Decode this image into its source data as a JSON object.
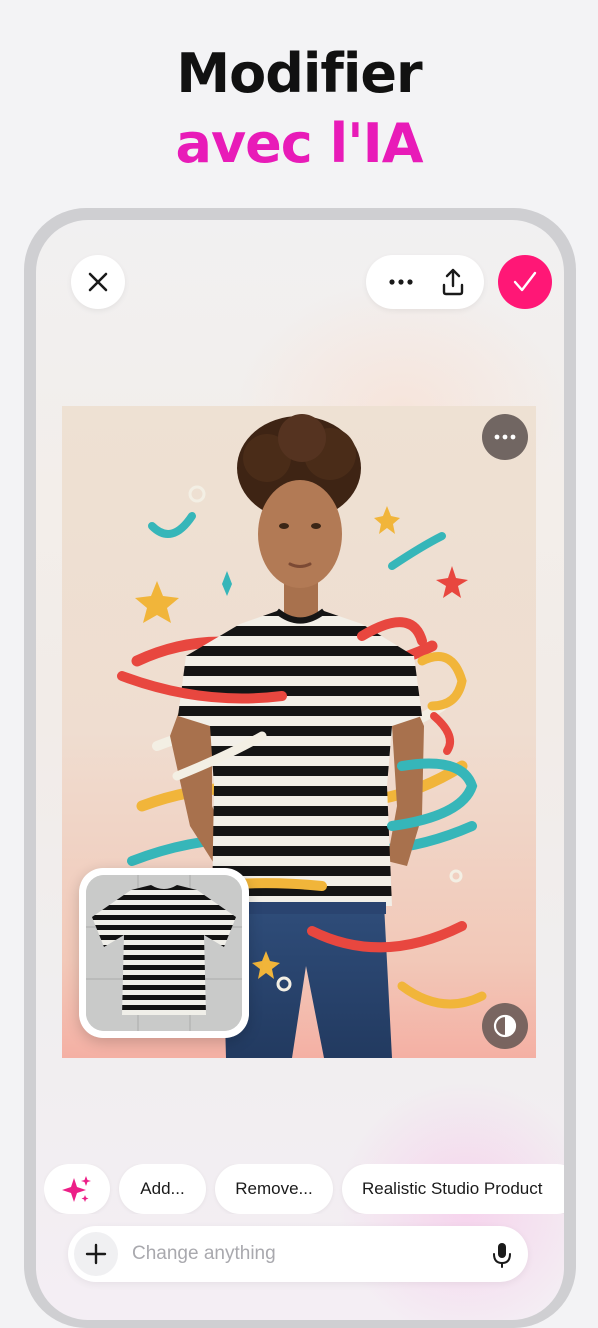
{
  "headline": {
    "line1": "Modifier",
    "line2": "avec l'IA"
  },
  "topbar": {
    "close_icon": "close-icon",
    "more_icon": "more-horizontal-icon",
    "share_icon": "share-icon",
    "confirm_icon": "check-icon"
  },
  "canvas": {
    "image_description": "photo-edit-preview",
    "more_icon": "more-horizontal-icon",
    "compare_icon": "compare-icon",
    "reference_thumbnail": "reference-image-thumbnail"
  },
  "suggestions": {
    "sparkle_icon": "sparkle-icon",
    "items": [
      "Add...",
      "Remove...",
      "Realistic Studio Product"
    ]
  },
  "prompt": {
    "placeholder": "Change anything",
    "plus_icon": "plus-icon",
    "mic_icon": "mic-icon"
  },
  "colors": {
    "accent_pink": "#ff1776",
    "headline_magenta": "#e81bb8",
    "headline_black": "#111111"
  }
}
